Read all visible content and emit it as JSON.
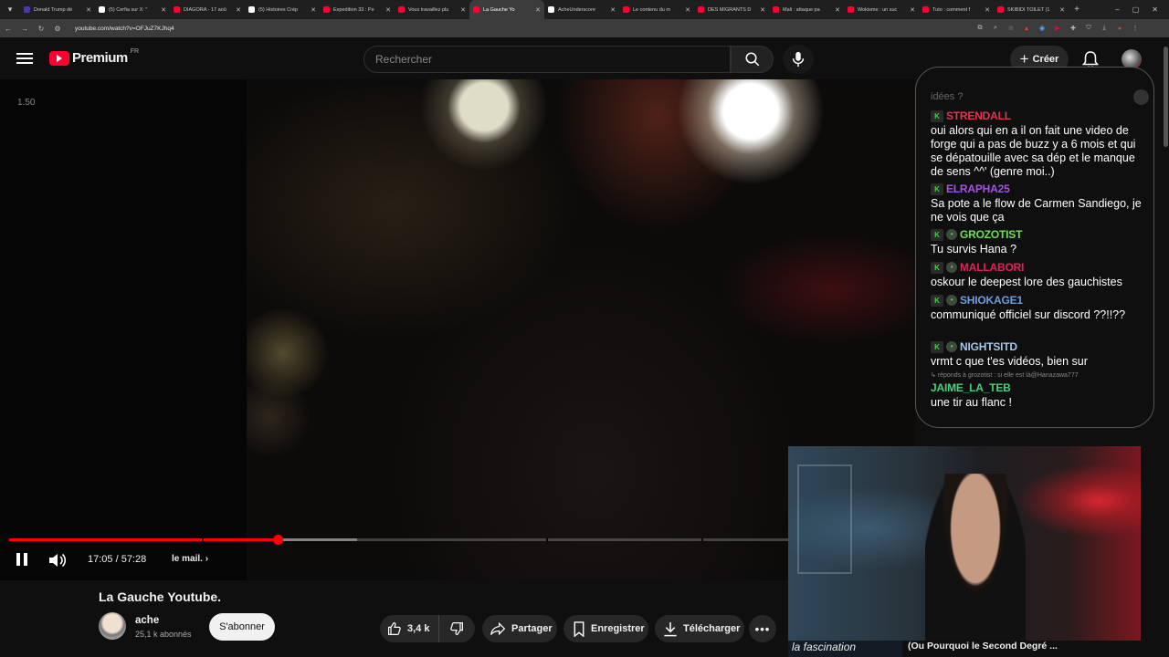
{
  "browser": {
    "tabs": [
      {
        "title": "Donald Trump dé",
        "favicon_color": "#4a3aa8",
        "active": false
      },
      {
        "title": "(5) Cerfia sur X: \"",
        "favicon_color": "#ffffff",
        "active": false
      },
      {
        "title": "DIAGORA - 17 aoû",
        "favicon_color": "#ff0033",
        "active": false
      },
      {
        "title": "(5) Histoires Crép",
        "favicon_color": "#ffffff",
        "active": false
      },
      {
        "title": "Expedition 33 : Pe",
        "favicon_color": "#ff0033",
        "active": false
      },
      {
        "title": "Vous travaillez plu",
        "favicon_color": "#ff0033",
        "active": false
      },
      {
        "title": "La Gauche Yo",
        "favicon_color": "#ff0033",
        "active": true
      },
      {
        "title": "AcheUnderscore",
        "favicon_color": "#ffffff",
        "active": false
      },
      {
        "title": "Le contenu du m",
        "favicon_color": "#ff0033",
        "active": false
      },
      {
        "title": "DES MIGRANTS D",
        "favicon_color": "#ff0033",
        "active": false
      },
      {
        "title": "Mali : attaque pa",
        "favicon_color": "#ff0033",
        "active": false
      },
      {
        "title": "Wokisme : un suc",
        "favicon_color": "#ff0033",
        "active": false
      },
      {
        "title": "Tuto : comment f",
        "favicon_color": "#ff0033",
        "active": false
      },
      {
        "title": "SKIBIDI TOILET (1",
        "favicon_color": "#ff0033",
        "active": false
      }
    ],
    "url": "youtube.com/watch?v=OFJuZ7KJhq4"
  },
  "header": {
    "logo_text": "Premium",
    "country_code": "FR",
    "search_placeholder": "Rechercher",
    "create_label": "Créer",
    "icons": [
      "menu-icon",
      "search-icon",
      "microphone-icon",
      "plus-icon",
      "bell-icon"
    ]
  },
  "player": {
    "speed_overlay": "1.50",
    "current_time": "17:05",
    "duration": "57:28",
    "time_display": "17:05 / 57:28",
    "played_fraction": 0.297,
    "buffered_fraction": 0.385,
    "chapter_label": "le mail.",
    "progress_color": "#ff0000"
  },
  "chat": {
    "partial_top": "idées ?",
    "messages": [
      {
        "user": "STRENDALL",
        "color": "#e0374f",
        "badges": [
          "K"
        ],
        "text": "oui alors qui en a il on fait une video de forge qui a pas de buzz y a 6 mois et qui se dépatouille avec sa dép et le manque de sens ^^' (genre moi..)"
      },
      {
        "user": "ELRAPHA25",
        "color": "#a553e0",
        "badges": [
          "K"
        ],
        "text": "Sa pote a le flow de Carmen Sandiego, je ne vois que ça"
      },
      {
        "user": "GROZOTIST",
        "color": "#6ee05a",
        "badges": [
          "K",
          "face"
        ],
        "text": "Tu survis Hana ?"
      },
      {
        "user": "MALLABORI",
        "color": "#e0235a",
        "badges": [
          "K",
          "face"
        ],
        "text": "oskour le deepest lore des gauchistes"
      },
      {
        "user": "SHIOKAGE1",
        "color": "#6f9de0",
        "badges": [
          "K",
          "face"
        ],
        "text": "communiqué officiel sur discord ??!!??"
      },
      {
        "user": "NIGHTSITD",
        "color": "#a6c8e8",
        "badges": [
          "K",
          "face"
        ],
        "text": "vrmt c que t'es vidéos, bien sur"
      },
      {
        "user": "JAIME_LA_TEB",
        "color": "#4ad07a",
        "badges": [],
        "reply": "↳ réponds à grozotist : si elle est là@Hanazawa777",
        "text": "une tir au flanc !"
      }
    ]
  },
  "webcam": {
    "caption_left": "la fascination",
    "caption_right": "(Ou Pourquoi le Second Degré ..."
  },
  "video_info": {
    "title": "La Gauche Youtube.",
    "channel_name": "ache",
    "subscribers": "25,1 k abonnés",
    "subscribe_label": "S'abonner",
    "like_count": "3,4 k",
    "share_label": "Partager",
    "save_label": "Enregistrer",
    "download_label": "Télécharger",
    "more_label": "•••"
  }
}
